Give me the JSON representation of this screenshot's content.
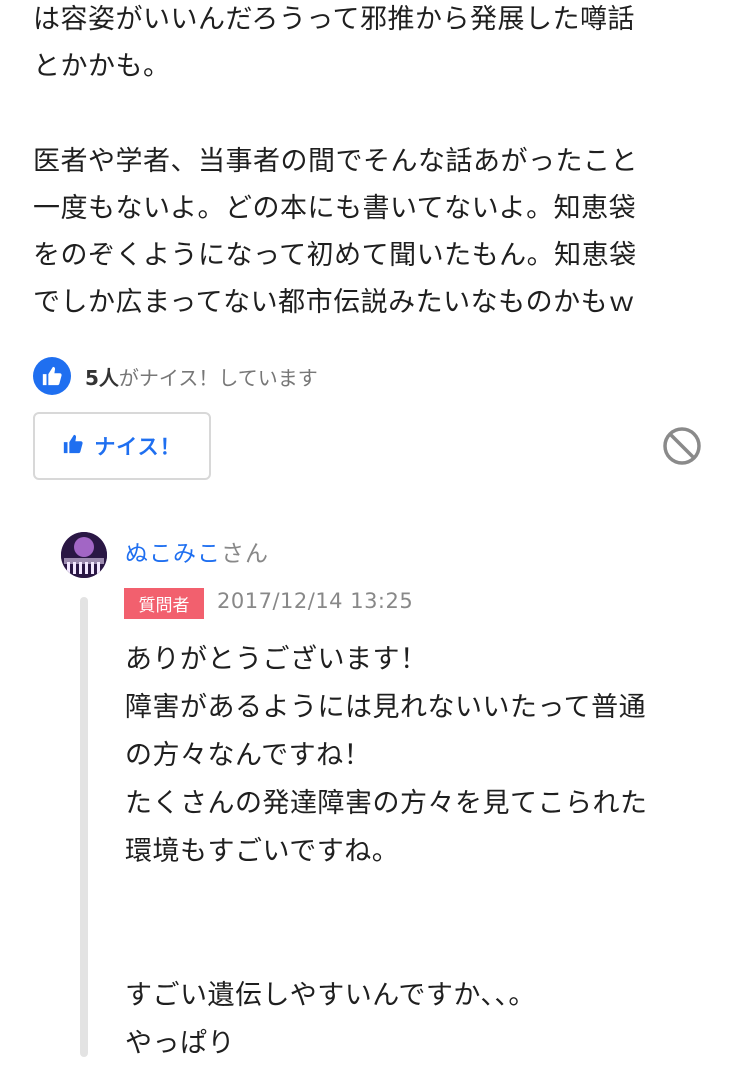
{
  "answer": {
    "lines": [
      "は容姿がいいんだろうって邪推から発展した噂話",
      "とかかも。",
      "医者や学者、当事者の間でそんな話あがったこと",
      "一度もないよ。どの本にも書いてないよ。知恵袋",
      "をのぞくようになって初めて聞いたもん。知恵袋",
      "でしか広まってない都市伝説みたいなものかもｗ"
    ]
  },
  "nice": {
    "count": "5人",
    "count_suffix": "がナイス！しています",
    "button_label": "ナイス！"
  },
  "reply": {
    "name": "ぬこみこ",
    "name_suffix": "さん",
    "badge": "質問者",
    "date": "2017/12/14 13:25",
    "lines": [
      "ありがとうございます！",
      "障害があるようには見れないいたって普通",
      "の方々なんですね！",
      "たくさんの発達障害の方々を見てこられた",
      "環境もすごいですね。",
      "すごい遺伝しやすいんですか、、。",
      "やっぱり"
    ]
  },
  "colors": {
    "accent": "#1f6ff0",
    "badge": "#f2606e",
    "muted": "#888888"
  },
  "icons": {
    "thumbs_up": "thumbs-up-icon",
    "block": "block-icon"
  }
}
